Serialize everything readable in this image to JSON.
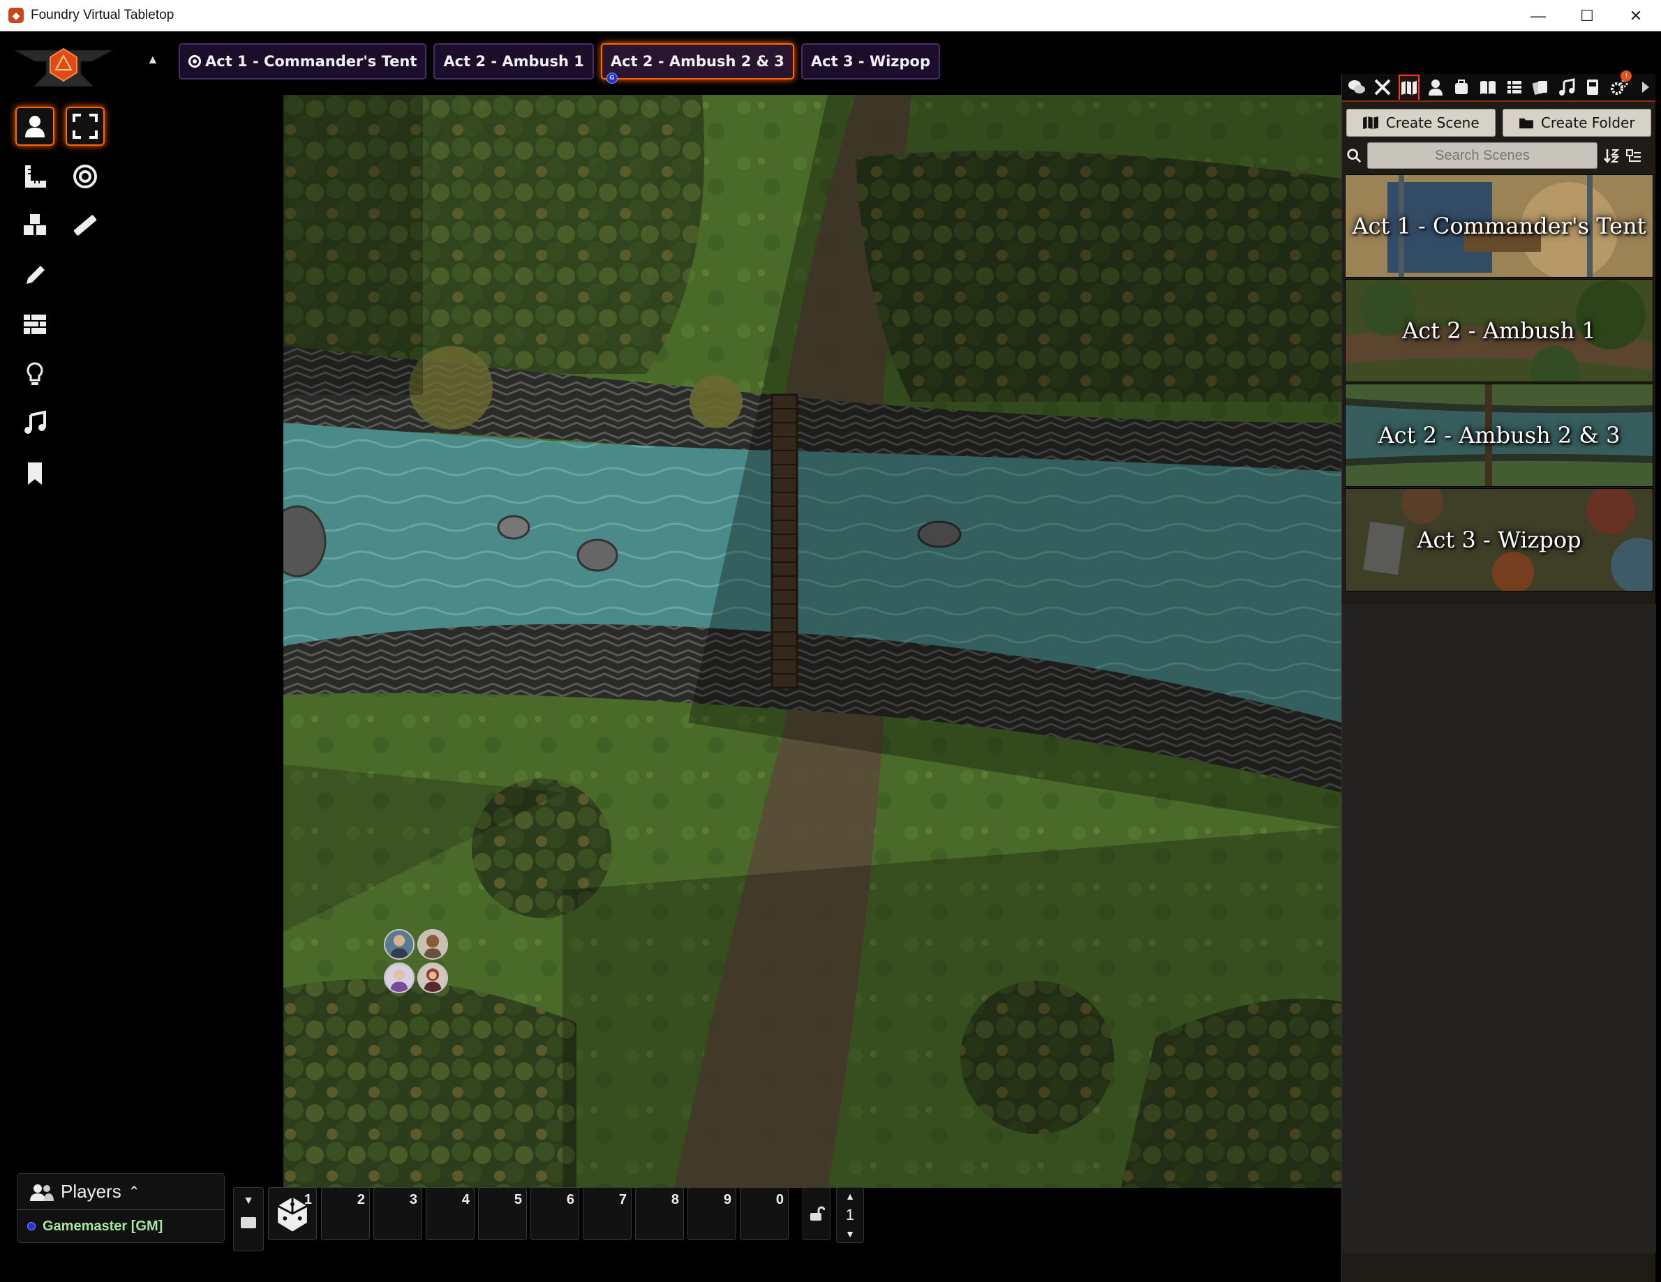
{
  "window": {
    "title": "Foundry Virtual Tabletop",
    "minimize": "—",
    "maximize": "☐",
    "close": "✕"
  },
  "scene_nav": {
    "tabs": [
      {
        "label": "Act 1 - Commander's Tent",
        "active": false,
        "has_target_icon": true
      },
      {
        "label": "Act 2 - Ambush 1",
        "active": false
      },
      {
        "label": "Act 2 - Ambush 2 & 3",
        "active": true,
        "user_dot": "G"
      },
      {
        "label": "Act 3 - Wizpop",
        "active": false
      }
    ]
  },
  "controls": [
    "token-icon",
    "fullscreen-icon",
    "ruler-icon",
    "target-icon",
    "tiles-icon",
    "measure-icon",
    "pencil-icon",
    "walls-icon",
    "light-icon",
    "music-icon",
    "bookmark-icon"
  ],
  "players": {
    "title": "Players",
    "list": [
      {
        "name": "Gamemaster [GM]",
        "color": "#2233dd"
      }
    ]
  },
  "hotbar": {
    "slots": [
      "1",
      "2",
      "3",
      "4",
      "5",
      "6",
      "7",
      "8",
      "9",
      "0"
    ],
    "page": "1"
  },
  "sidebar": {
    "tabs": [
      "chat-icon",
      "combat-icon",
      "scenes-icon",
      "actors-icon",
      "items-icon",
      "journal-icon",
      "tables-icon",
      "cards-icon",
      "playlists-icon",
      "compendium-icon",
      "settings-icon",
      "collapse-icon"
    ],
    "notification": "!",
    "create_scene": "Create Scene",
    "create_folder": "Create Folder",
    "search_placeholder": "Search Scenes",
    "scenes": [
      {
        "name": "Act 1 - Commander's Tent",
        "colors": [
          "#3d5a78",
          "#8a7a55",
          "#c4a571"
        ]
      },
      {
        "name": "Act 2 - Ambush 1",
        "colors": [
          "#4a5a2a",
          "#6b5238",
          "#3e5a2a"
        ]
      },
      {
        "name": "Act 2 - Ambush 2 & 3",
        "colors": [
          "#416f6e",
          "#4f6d3a",
          "#2f3a2c"
        ]
      },
      {
        "name": "Act 3 - Wizpop",
        "colors": [
          "#4a4a30",
          "#8a4a25",
          "#5a6a3a"
        ]
      }
    ]
  }
}
